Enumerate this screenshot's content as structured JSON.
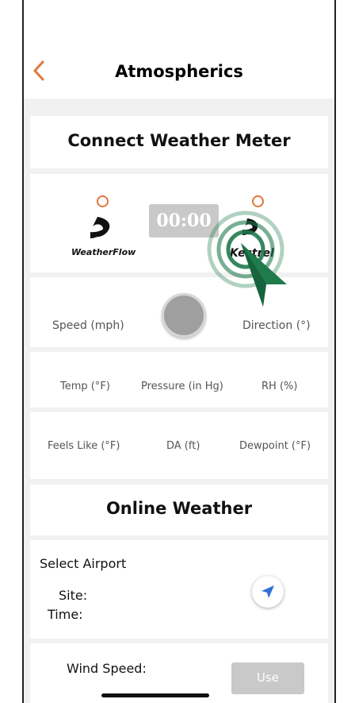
{
  "nav": {
    "title": "Atmospherics",
    "back_icon": "chevron-left-icon"
  },
  "connect": {
    "title": "Connect Weather Meter",
    "timer": "00:00",
    "weatherflow_logo_text": "WeatherFlow",
    "kestrel_logo_text": "Kestrel"
  },
  "meter": {
    "speed_label": "Speed (mph)",
    "direction_label": "Direction (°)",
    "temp_label": "Temp (°F)",
    "pressure_label": "Pressure (in Hg)",
    "rh_label": "RH (%)",
    "feels_like_label": "Feels Like (°F)",
    "da_label": "DA (ft)",
    "dewpoint_label": "Dewpoint (°F)"
  },
  "online": {
    "title": "Online Weather",
    "select_airport": "Select Airport",
    "site_label": "Site:",
    "time_label": "Time:",
    "wind_speed_label": "Wind Speed:",
    "use_button": "Use"
  },
  "colors": {
    "accent": "#e2773a",
    "cursor_green": "#1f7a4c",
    "locate_blue": "#2f6fd6",
    "timer_bg": "#c9c9c9"
  }
}
